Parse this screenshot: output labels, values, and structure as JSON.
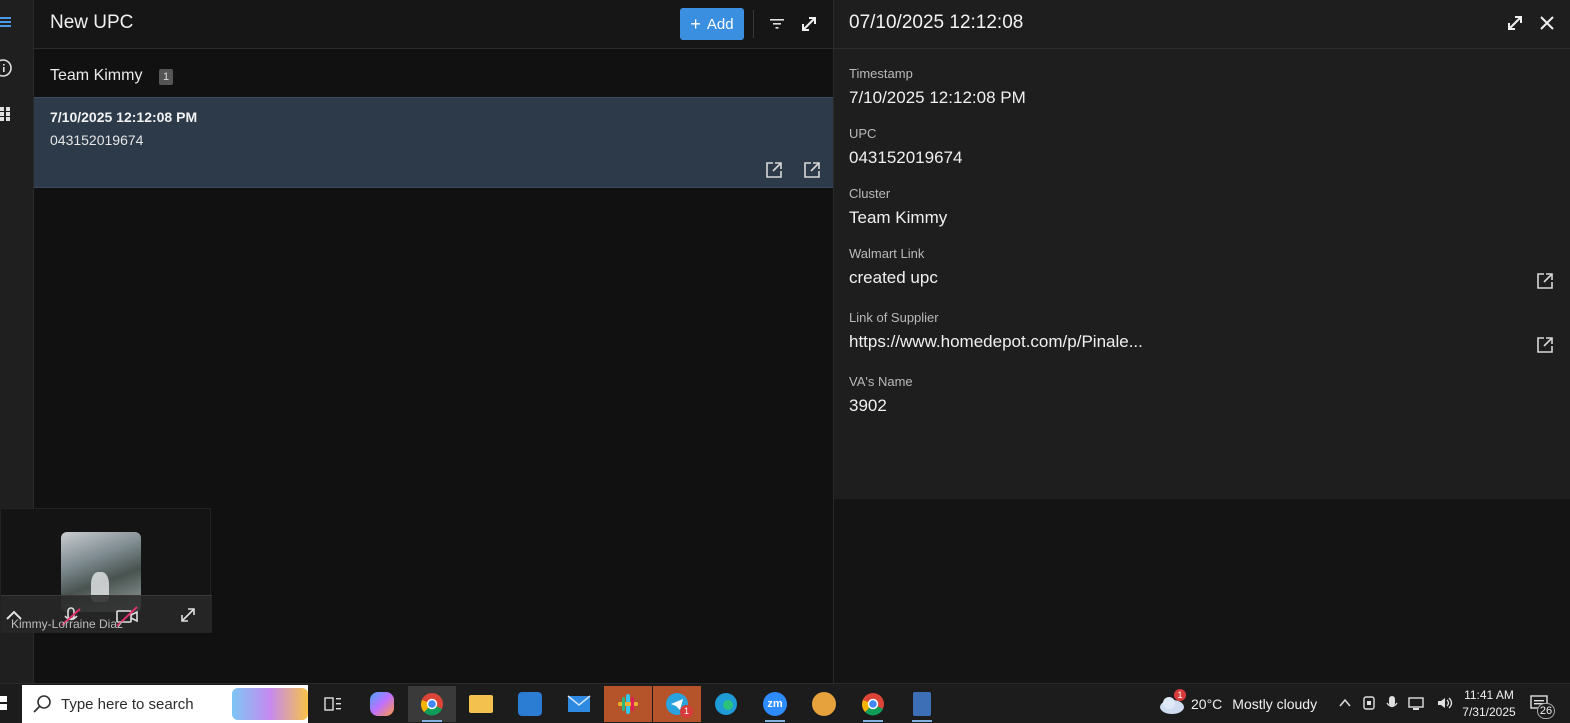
{
  "list": {
    "title": "New UPC",
    "add_label": "Add",
    "group": {
      "label": "Team Kimmy",
      "count": "1"
    },
    "record": {
      "timestamp": "7/10/2025 12:12:08 PM",
      "upc": "043152019674"
    }
  },
  "detail": {
    "title": "07/10/2025 12:12:08",
    "fields": [
      {
        "label": "Timestamp",
        "value": "7/10/2025 12:12:08 PM"
      },
      {
        "label": "UPC",
        "value": "043152019674"
      },
      {
        "label": "Cluster",
        "value": "Team Kimmy"
      },
      {
        "label": "Walmart Link",
        "value": "created upc"
      },
      {
        "label": "Link of Supplier",
        "value": "https://www.homedepot.com/p/Pinale..."
      },
      {
        "label": "VA's Name",
        "value": "3902"
      }
    ]
  },
  "video": {
    "participant_name": "Kimmy-Lorraine Diaz"
  },
  "taskbar": {
    "search_placeholder": "Type here to search",
    "weather": {
      "temperature": "20°C",
      "condition": "Mostly cloudy",
      "alert_count": "1"
    },
    "time": "11:41 AM",
    "date": "7/31/2025",
    "notification_count": "26",
    "telegram_badge": "1"
  },
  "colors": {
    "accent": "#3b8fe0",
    "selected_row": "#2c3a4a"
  }
}
